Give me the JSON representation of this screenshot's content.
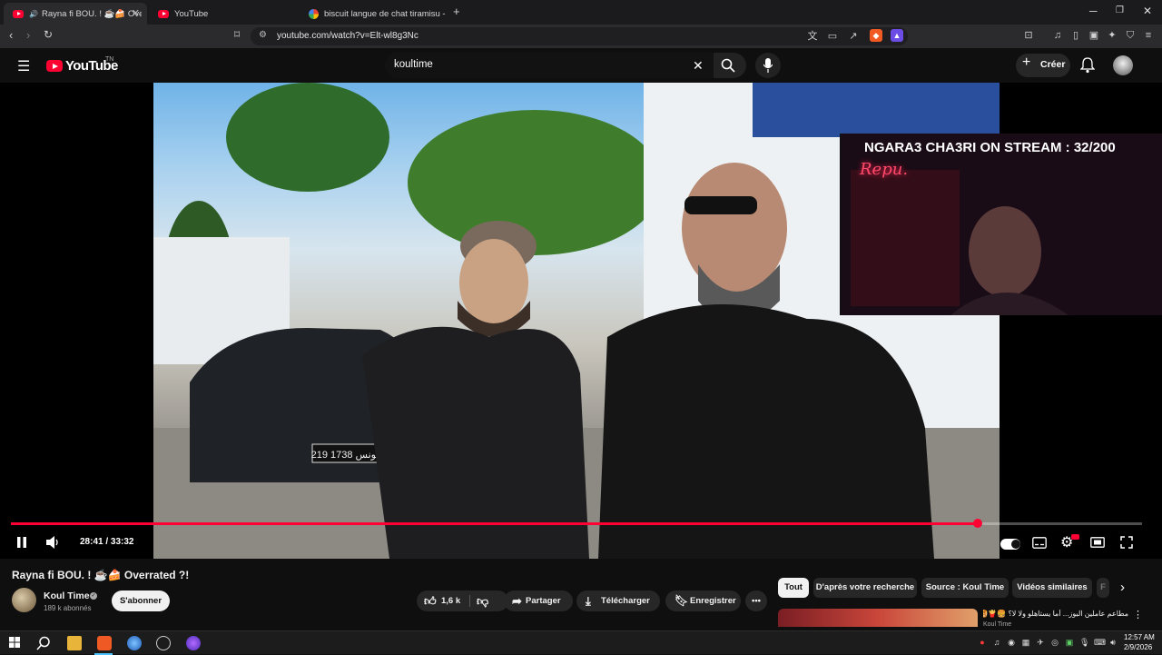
{
  "browser": {
    "tabs": [
      {
        "label": "Rayna fi BOU. ! ☕🍰 Overra",
        "active": true
      },
      {
        "label": "YouTube",
        "active": false
      },
      {
        "label": "biscuit langue de chat tiramisu - Goo",
        "active": false
      }
    ],
    "new_tab": "+",
    "url": "youtube.com/watch?v=Elt-wl8g3Nc"
  },
  "youtube": {
    "logo_text": "YouTube",
    "country_code": "TN",
    "search_query": "koultime",
    "create_label": "Créer"
  },
  "player": {
    "time_display": "28:41 / 33:32",
    "progress_fraction": 0.855,
    "overlay_text": "NGARA3 CHA3RI ON STREAM : 32/200",
    "overlay_neon": "Repu."
  },
  "video": {
    "title": "Rayna fi BOU. ! ☕🍰 Overrated ?!",
    "channel_name": "Koul Time",
    "subscribers": "189 k abonnés",
    "subscribe_label": "S'abonner",
    "likes": "1,6 k",
    "share_label": "Partager",
    "download_label": "Télécharger",
    "save_label": "Enregistrer"
  },
  "chips": [
    "Tout",
    "D'après votre recherche",
    "Source : Koul Time",
    "Vidéos similaires",
    "F"
  ],
  "recommendation": {
    "title": "مطاعم عاملين البوز... أما يستاهلو ولا لا؟ 🍔🍟🥞",
    "channel": "Koul Time"
  },
  "taskbar": {
    "time": "12:57 AM",
    "date": "2/9/2026"
  },
  "colors": {
    "brand_red": "#ff0033",
    "background": "#0f0f0f",
    "surface": "#272727"
  }
}
